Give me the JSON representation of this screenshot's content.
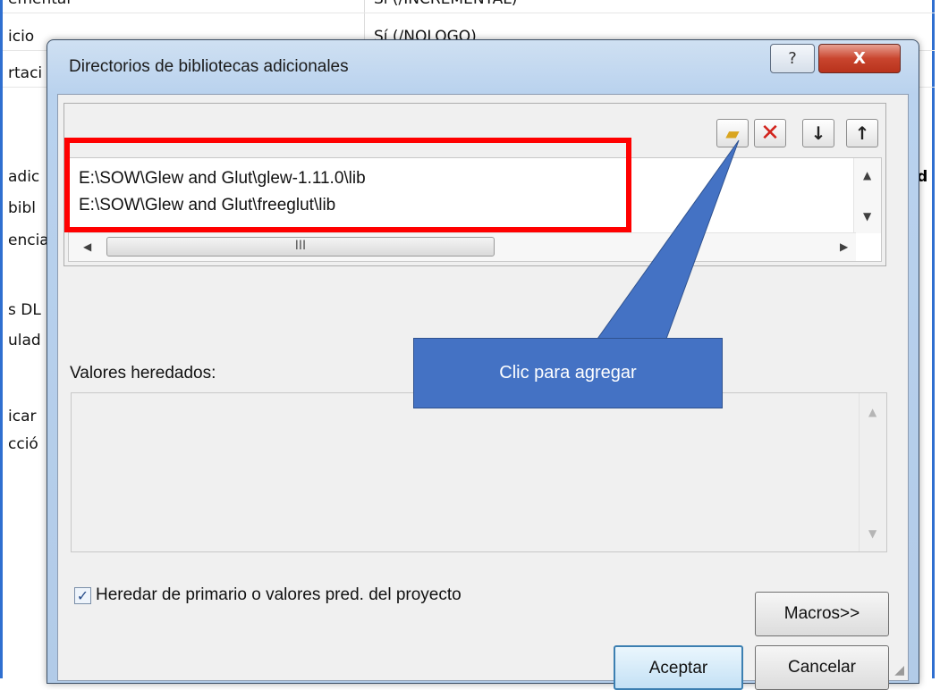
{
  "background": {
    "rows": [
      {
        "label": "ementar",
        "value": "Sí (/INCREMENTAL)"
      },
      {
        "label": "icio",
        "value": "Sí (/NOLOGO)"
      },
      {
        "label": "rtaci",
        "value": ""
      },
      {
        "label": "",
        "value": ""
      },
      {
        "label": "adic",
        "value": ""
      },
      {
        "label": "bibl",
        "value": ""
      },
      {
        "label": "encia",
        "value": ""
      },
      {
        "label": "",
        "value": ""
      },
      {
        "label": "s DL",
        "value": ""
      },
      {
        "label": "ulad",
        "value": ""
      },
      {
        "label": "",
        "value": ""
      },
      {
        "label": "icar",
        "value": ""
      },
      {
        "label": "cció",
        "value": ""
      }
    ],
    "right_fragment": "nd"
  },
  "dialog": {
    "title": "Directorios de bibliotecas adicionales",
    "help_label": "?",
    "close_label": "X"
  },
  "toolbar": {
    "new_line_icon": "new-folder-icon",
    "delete_icon": "delete-icon",
    "move_down_icon": "arrow-down-icon",
    "move_up_icon": "arrow-up-icon",
    "new_glyph": "▰",
    "delete_glyph": "✕",
    "down_glyph": "↓",
    "up_glyph": "↑"
  },
  "directories": {
    "items": [
      "E:\\SOW\\Glew and Glut\\glew-1.11.0\\lib",
      "E:\\SOW\\Glew and Glut\\freeglut\\lib"
    ],
    "scroll_thumb_grip": "III"
  },
  "inherited": {
    "label": "Valores heredados:"
  },
  "options": {
    "inherit_checked": true,
    "inherit_label": "Heredar de primario o valores pred. del proyecto",
    "check_glyph": "✓"
  },
  "buttons": {
    "macros": "Macros>>",
    "accept": "Aceptar",
    "cancel": "Cancelar"
  },
  "annotation": {
    "callout_text": "Clic para agregar",
    "callout_color": "#4472c4",
    "highlight_color": "#ff0000"
  }
}
